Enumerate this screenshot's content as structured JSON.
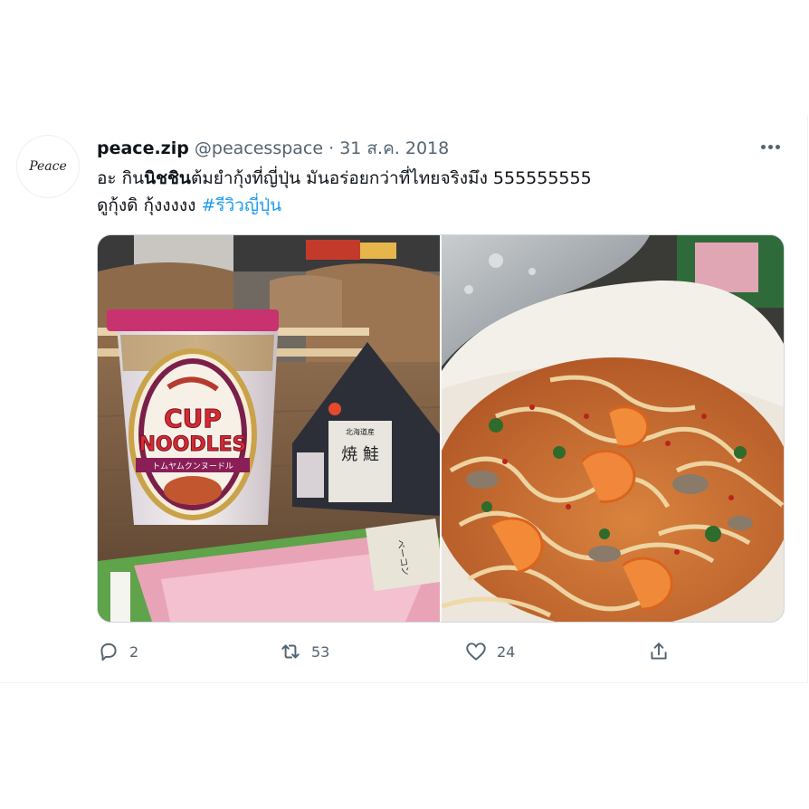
{
  "tweet": {
    "avatar_text": "Peace",
    "display_name": "peace.zip",
    "handle": "@peacesspace",
    "separator": "·",
    "date": "31 ส.ค. 2018",
    "text_part1": "อะ กิน",
    "text_bold": "นิชชิน",
    "text_part2": "ต้มยำกุ้งที่ญี่ปุ่น มันอร่อยกว่าที่ไทยจริงมึง 555555555",
    "text_line2": "ดูกุ้งดิ กุ้งงงงง ",
    "hashtag": "#รีวิวญี่ปุ่น"
  },
  "photos": {
    "left": {
      "cup_line1": "CUP",
      "cup_line2": "NOODLES",
      "cup_band": "トムヤムクンヌードル",
      "onigiri_label": "焼 鮭",
      "onigiri_sub": "北海道産",
      "bacon_label": "ベーコン"
    }
  },
  "actions": {
    "reply_count": "2",
    "retweet_count": "53",
    "like_count": "24"
  },
  "icons": {
    "reply": "reply-icon",
    "retweet": "retweet-icon",
    "like": "heart-icon",
    "share": "share-icon",
    "more": "more-icon"
  },
  "colors": {
    "link": "#1d9bf0",
    "secondary": "#536471",
    "text": "#0f1419"
  }
}
